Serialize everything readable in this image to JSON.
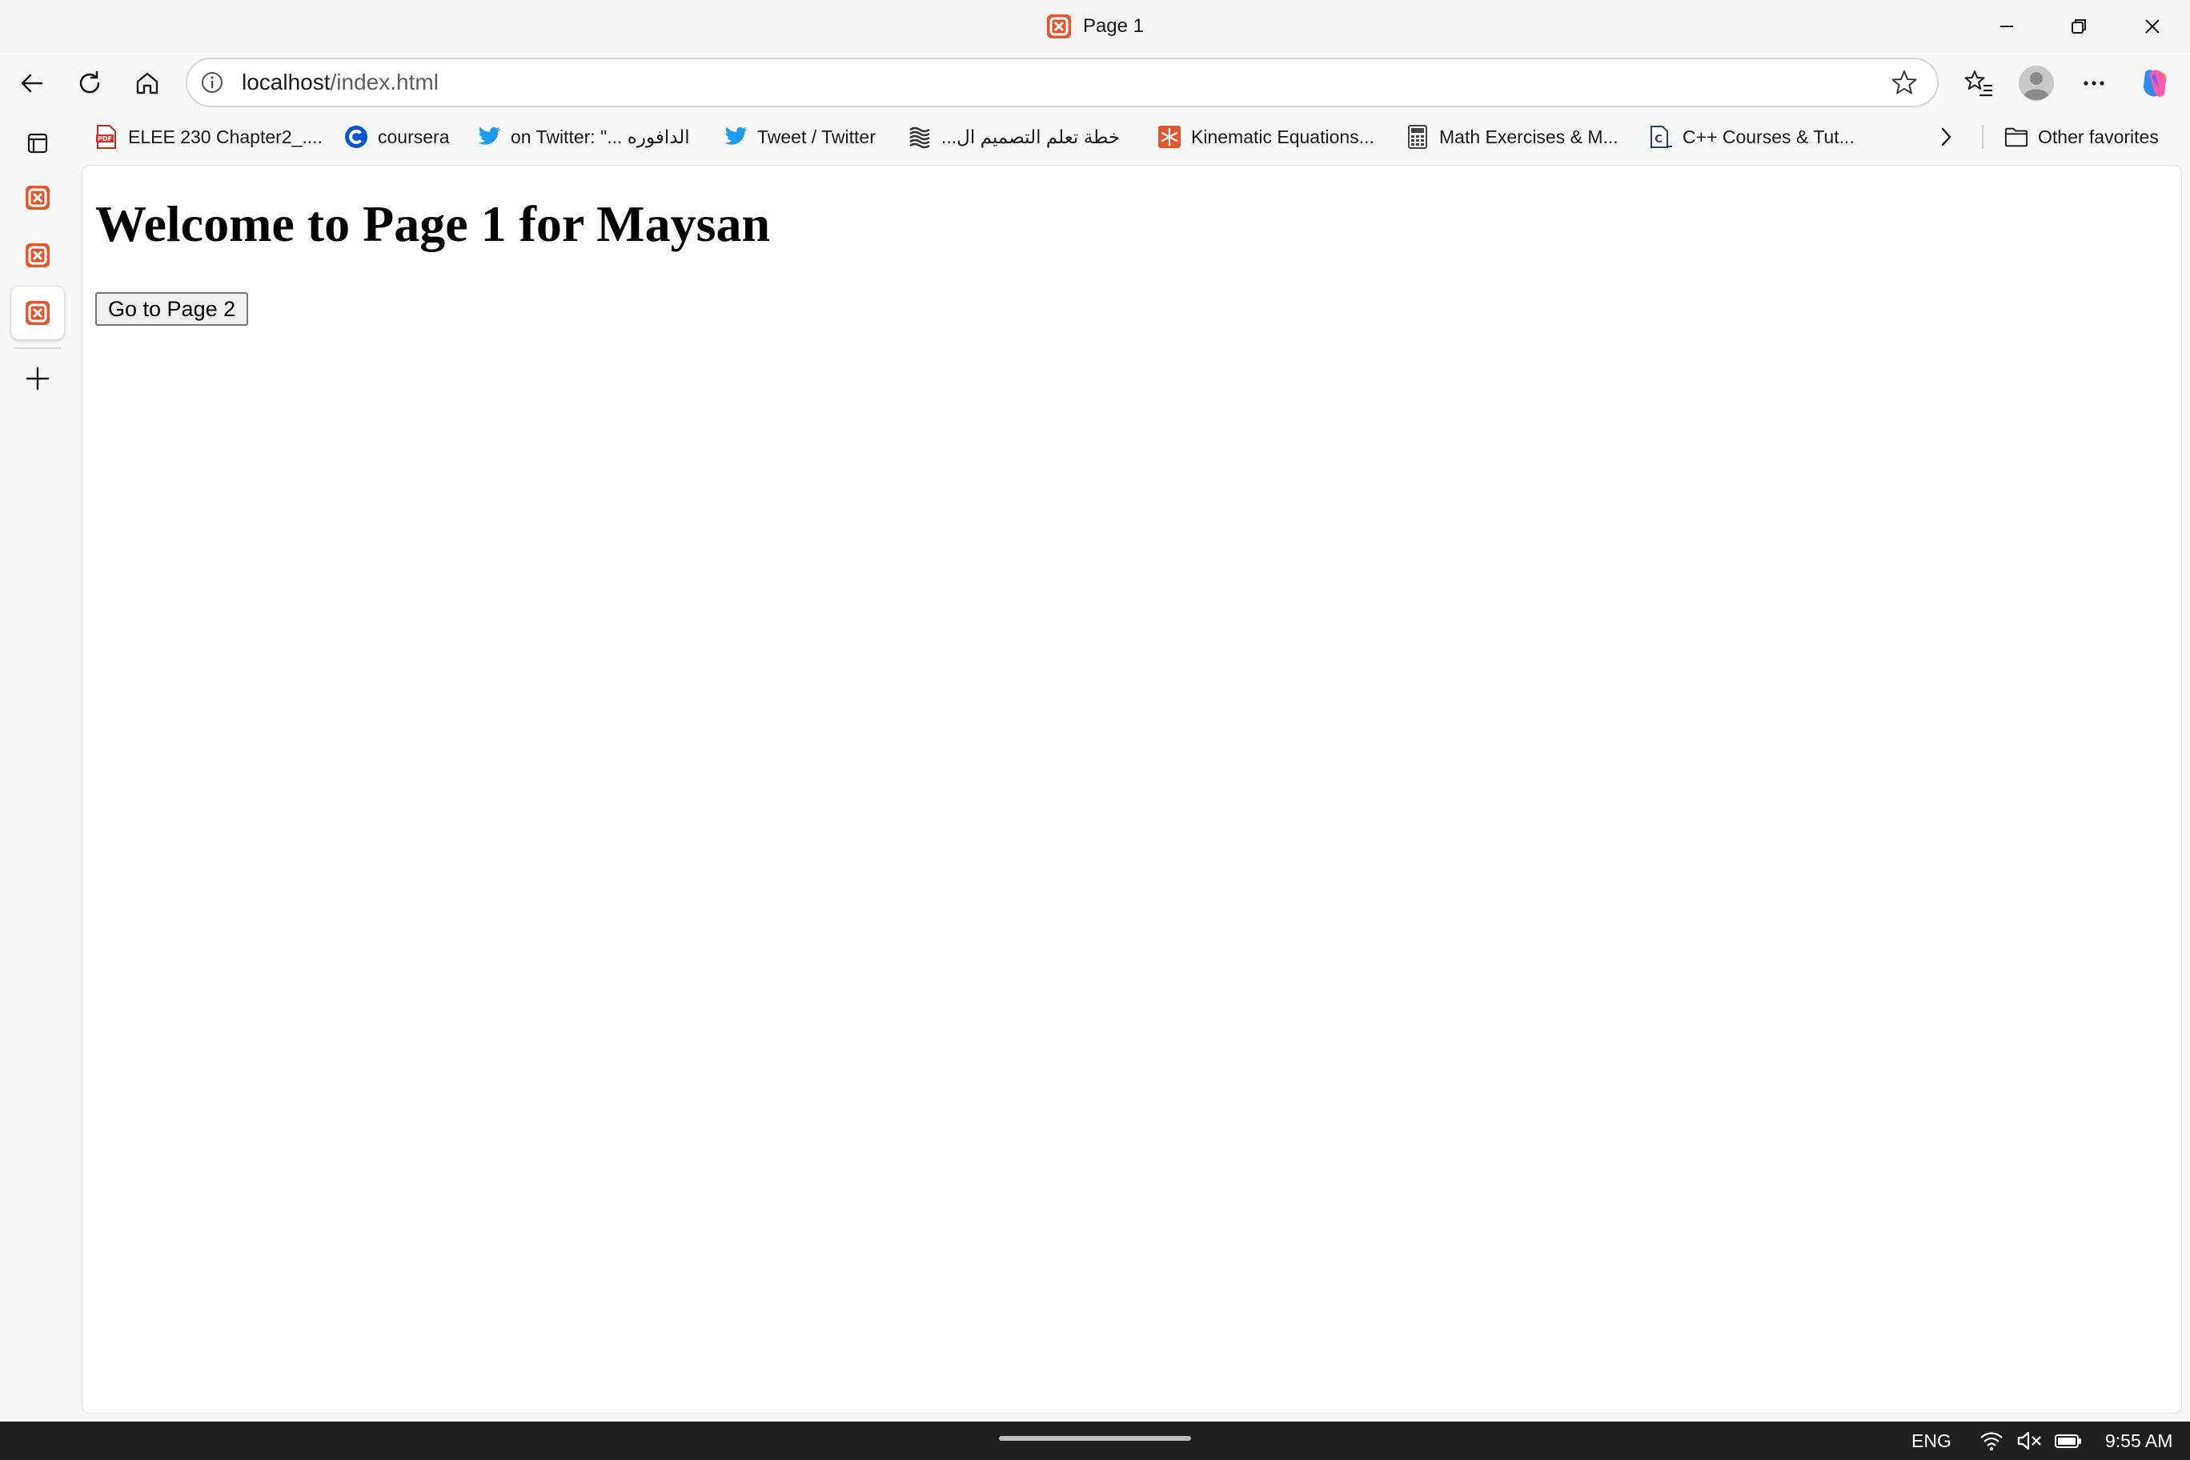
{
  "window": {
    "title": "Page 1",
    "buttons": [
      "minimize",
      "restore",
      "close"
    ]
  },
  "toolbar": {
    "url_host": "localhost",
    "url_path": "/index.html"
  },
  "bookmarks": [
    {
      "label": "ELEE 230 Chapter2_....",
      "icon": "pdf-icon"
    },
    {
      "label": "coursera",
      "icon": "coursera-icon"
    },
    {
      "label": "on Twitter: \"... الدافوره",
      "icon": "twitter-icon"
    },
    {
      "label": "Tweet / Twitter",
      "icon": "twitter-icon"
    },
    {
      "label": "خطة تعلم التصميم ال...",
      "icon": "stack-icon"
    },
    {
      "label": "Kinematic Equations...",
      "icon": "snowflake-icon"
    },
    {
      "label": "Math Exercises & M...",
      "icon": "calculator-icon"
    },
    {
      "label": "C++ Courses & Tut...",
      "icon": "cpp-doc-icon"
    }
  ],
  "other_favorites": "Other favorites",
  "page": {
    "heading": "Welcome to Page 1 for Maysan",
    "button_label": "Go to Page 2"
  },
  "taskbar": {
    "language": "ENG",
    "time": "9:55 AM"
  },
  "colors": {
    "xampp_orange": "#e4572e",
    "twitter_blue": "#1d9bf0",
    "coursera_blue": "#0056d2"
  }
}
